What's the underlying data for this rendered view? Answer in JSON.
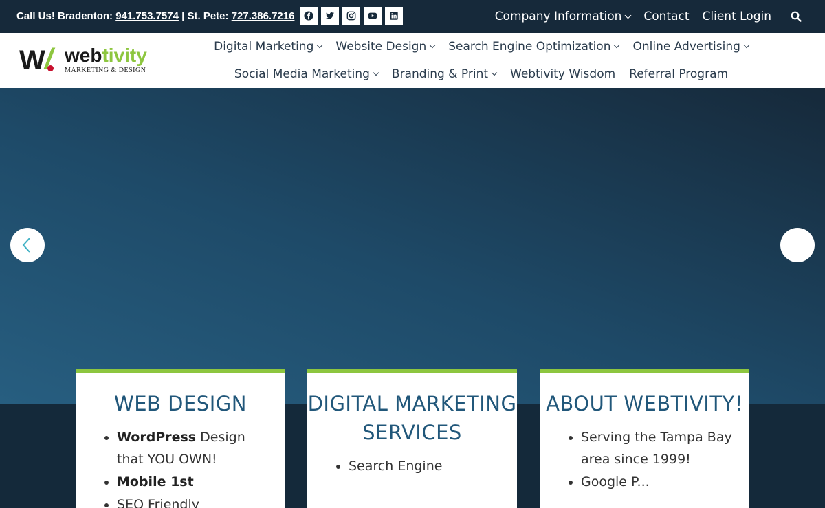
{
  "topbar": {
    "call_prefix": "Call Us! Bradenton:",
    "phone_bradenton": "941.753.7574",
    "separator": "| St. Pete:",
    "phone_stpete": "727.386.7216",
    "socials": [
      "facebook-icon",
      "twitter-icon",
      "instagram-icon",
      "youtube-icon",
      "linkedin-icon"
    ],
    "nav": {
      "company": "Company Information",
      "contact": "Contact",
      "login": "Client Login"
    }
  },
  "header": {
    "logo": {
      "w": "W",
      "web": "web",
      "tivity": "tivity",
      "tagline": "MARKETING & DESIGN"
    },
    "nav_row1": {
      "digital": "Digital Marketing",
      "website": "Website Design",
      "seo": "Search Engine Optimization",
      "advertising": "Online Advertising"
    },
    "nav_row2": {
      "social": "Social Media Marketing",
      "branding": "Branding & Print",
      "wisdom": "Webtivity Wisdom",
      "referral": "Referral Program"
    }
  },
  "colors": {
    "navy": "#16293a",
    "accent_green": "#8dc63f",
    "heading_blue": "#21577a",
    "logo_red": "#c8102e"
  },
  "cards": {
    "web_design": {
      "title": "WEB DESIGN",
      "item1_bold": "WordPress",
      "item1_rest": " Design that YOU OWN!",
      "item2_bold": "Mobile 1st",
      "item3": "SEO Friendly"
    },
    "digital_marketing": {
      "title": "DIGITAL MARKETING SERVICES",
      "item1": "Search Engine"
    },
    "about": {
      "title": "ABOUT WEBTIVITY!",
      "item1": "Serving the Tampa Bay area since 1999!",
      "item2": "Google P..."
    }
  }
}
